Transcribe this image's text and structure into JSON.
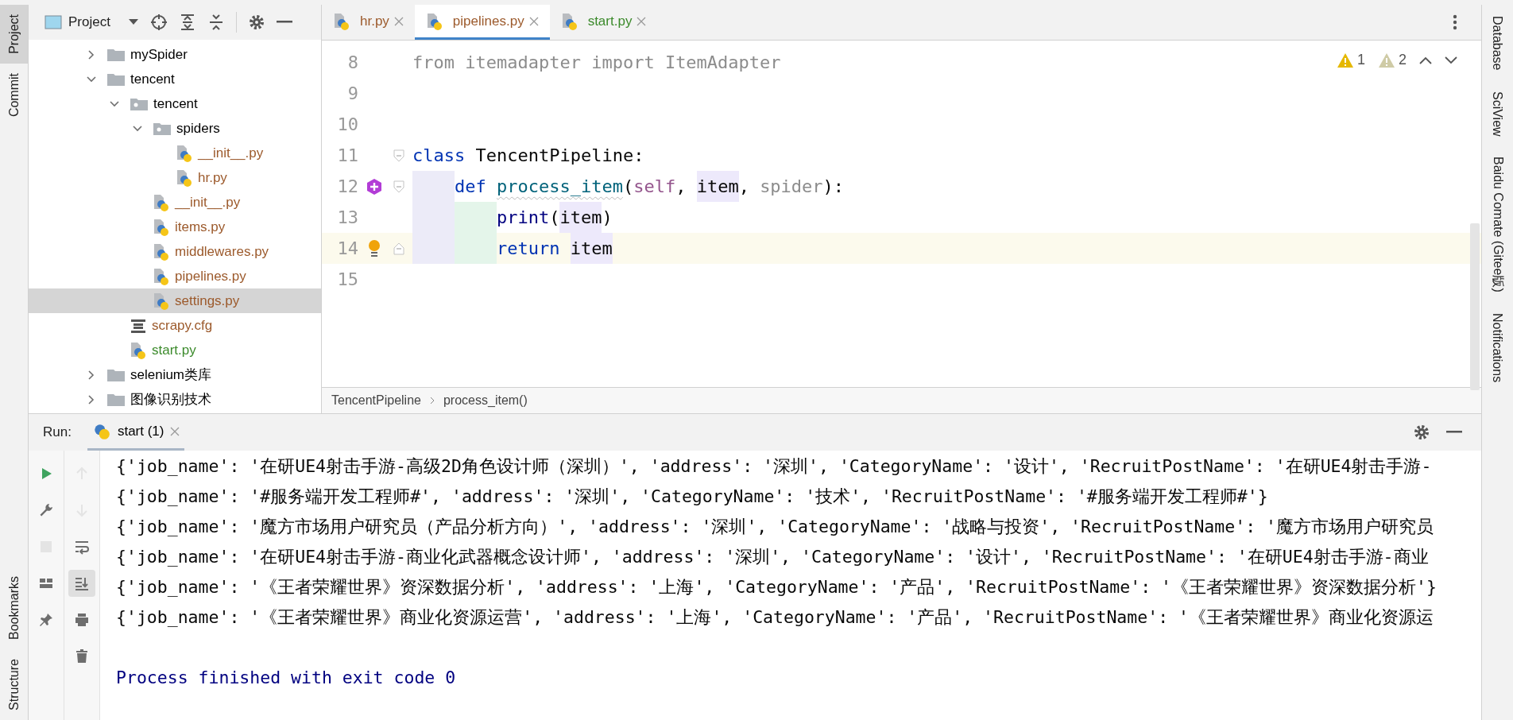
{
  "left_strip": {
    "top": [
      {
        "label": "Project",
        "selected": true
      },
      {
        "label": "Commit",
        "selected": false
      }
    ],
    "bottom": [
      "Bookmarks",
      "Structure"
    ]
  },
  "project_panel": {
    "title": "Project",
    "tree": [
      {
        "children": [
          {
            "label": "mySpider",
            "kind": "folder",
            "expanded": false,
            "selected": false,
            "color": "#000000"
          },
          {
            "label": "tencent",
            "kind": "folder",
            "expanded": true,
            "selected": false,
            "color": "#000000",
            "children": [
              {
                "label": "tencent",
                "kind": "package",
                "expanded": true,
                "selected": false,
                "color": "#000000",
                "children": [
                  {
                    "label": "spiders",
                    "kind": "package",
                    "expanded": true,
                    "selected": false,
                    "color": "#000000",
                    "children": [
                      {
                        "label": "__init__.py",
                        "kind": "python",
                        "selected": false,
                        "color": "#9c5a2c"
                      },
                      {
                        "label": "hr.py",
                        "kind": "python",
                        "selected": false,
                        "color": "#9c5a2c"
                      }
                    ]
                  },
                  {
                    "label": "__init__.py",
                    "kind": "python",
                    "selected": false,
                    "color": "#9c5a2c"
                  },
                  {
                    "label": "items.py",
                    "kind": "python",
                    "selected": false,
                    "color": "#9c5a2c"
                  },
                  {
                    "label": "middlewares.py",
                    "kind": "python",
                    "selected": false,
                    "color": "#9c5a2c"
                  },
                  {
                    "label": "pipelines.py",
                    "kind": "python",
                    "selected": false,
                    "color": "#9c5a2c"
                  },
                  {
                    "label": "settings.py",
                    "kind": "python",
                    "selected": true,
                    "color": "#9c5a2c"
                  }
                ]
              },
              {
                "label": "scrapy.cfg",
                "kind": "config",
                "selected": false,
                "color": "#9c5a2c"
              },
              {
                "label": "start.py",
                "kind": "python",
                "selected": false,
                "color": "#3b8a2b"
              }
            ]
          }
        ]
      },
      {
        "label": "selenium类库",
        "kind": "folder",
        "expanded": false,
        "selected": false,
        "color": "#000000"
      },
      {
        "label": "图像识别技术",
        "kind": "folder",
        "expanded": false,
        "selected": false,
        "color": "#000000"
      }
    ]
  },
  "editor": {
    "tabs": [
      {
        "label": "hr.py",
        "selected": false,
        "color": "#9c5a2c"
      },
      {
        "label": "pipelines.py",
        "selected": true,
        "color": "#9c5a2c"
      },
      {
        "label": "start.py",
        "selected": false,
        "color": "#3b8a2b"
      }
    ],
    "inspections": [
      {
        "kind": "warning",
        "count": "1"
      },
      {
        "kind": "weak-warning",
        "count": "2"
      }
    ],
    "lines": [
      {
        "number": "8",
        "current": false,
        "tokens": [
          {
            "text": "from itemadapter import ItemAdapter",
            "kind": "unused"
          }
        ]
      },
      {
        "number": "9",
        "current": false
      },
      {
        "number": "10",
        "current": false
      },
      {
        "number": "11",
        "current": false,
        "fold_start": true,
        "tokens": [
          {
            "text": "class",
            "kind": "keyword"
          },
          {
            "text": " TencentPipeline:",
            "kind": "plain"
          }
        ]
      },
      {
        "number": "12",
        "current": false,
        "fold_start": true,
        "implement_marker": true,
        "tokens": [
          {
            "text": "    def ",
            "kind": "keyword"
          },
          {
            "text": "process_item",
            "kind": "function"
          },
          {
            "text": "(",
            "kind": "plain"
          },
          {
            "text": "self",
            "kind": "self"
          },
          {
            "text": ", ",
            "kind": "plain"
          },
          {
            "text": "item",
            "kind": "ref"
          },
          {
            "text": ", ",
            "kind": "plain"
          },
          {
            "text": "spider",
            "kind": "unused"
          },
          {
            "text": "):",
            "kind": "plain"
          }
        ]
      },
      {
        "number": "13",
        "current": false,
        "tokens": [
          {
            "text": "        print",
            "kind": "builtin"
          },
          {
            "text": "(",
            "kind": "plain"
          },
          {
            "text": "item",
            "kind": "ref"
          },
          {
            "text": ")",
            "kind": "plain"
          }
        ]
      },
      {
        "number": "14",
        "current": true,
        "fold_end": true,
        "bulb": true,
        "tokens": [
          {
            "text": "        return ",
            "kind": "keyword"
          },
          {
            "text": "item",
            "kind": "ref"
          }
        ]
      },
      {
        "number": "15",
        "current": false
      }
    ],
    "breadcrumbs": [
      "TencentPipeline",
      "process_item()"
    ]
  },
  "run_panel": {
    "label": "Run:",
    "tabs": [
      {
        "label": "start (1)",
        "selected": true
      }
    ],
    "toolbar_1": [
      {
        "kind": "rerun",
        "disabled": false
      },
      {
        "kind": "wrench",
        "disabled": false
      },
      {
        "kind": "stop",
        "disabled": true
      },
      {
        "kind": "layout",
        "disabled": false
      },
      {
        "kind": "pin",
        "disabled": false
      }
    ],
    "toolbar_2": [
      {
        "kind": "up",
        "disabled": true,
        "selected": false
      },
      {
        "kind": "down",
        "disabled": true,
        "selected": false
      },
      {
        "kind": "wrap",
        "disabled": false,
        "selected": false
      },
      {
        "kind": "scroll-end",
        "disabled": false,
        "selected": true
      },
      {
        "kind": "print",
        "disabled": false,
        "selected": false
      },
      {
        "kind": "trash",
        "disabled": false,
        "selected": false
      }
    ],
    "console": [
      {
        "kind": "output",
        "text": "{'job_name': '在研UE4射击手游-高级2D角色设计师（深圳）', 'address': '深圳', 'CategoryName': '设计', 'RecruitPostName': '在研UE4射击手游-"
      },
      {
        "kind": "output",
        "text": "{'job_name': '#服务端开发工程师#', 'address': '深圳', 'CategoryName': '技术', 'RecruitPostName': '#服务端开发工程师#'}"
      },
      {
        "kind": "output",
        "text": "{'job_name': '魔方市场用户研究员（产品分析方向）', 'address': '深圳', 'CategoryName': '战略与投资', 'RecruitPostName': '魔方市场用户研究员"
      },
      {
        "kind": "output",
        "text": "{'job_name': '在研UE4射击手游-商业化武器概念设计师', 'address': '深圳', 'CategoryName': '设计', 'RecruitPostName': '在研UE4射击手游-商业"
      },
      {
        "kind": "output",
        "text": "{'job_name': '《王者荣耀世界》资深数据分析', 'address': '上海', 'CategoryName': '产品', 'RecruitPostName': '《王者荣耀世界》资深数据分析'}"
      },
      {
        "kind": "output",
        "text": "{'job_name': '《王者荣耀世界》商业化资源运营', 'address': '上海', 'CategoryName': '产品', 'RecruitPostName': '《王者荣耀世界》商业化资源运"
      },
      {
        "kind": "system",
        "text": "Process finished with exit code 0"
      }
    ]
  },
  "right_strip": [
    "Database",
    "SciView",
    "Baidu Comate (Gitee版)",
    "Notifications"
  ]
}
